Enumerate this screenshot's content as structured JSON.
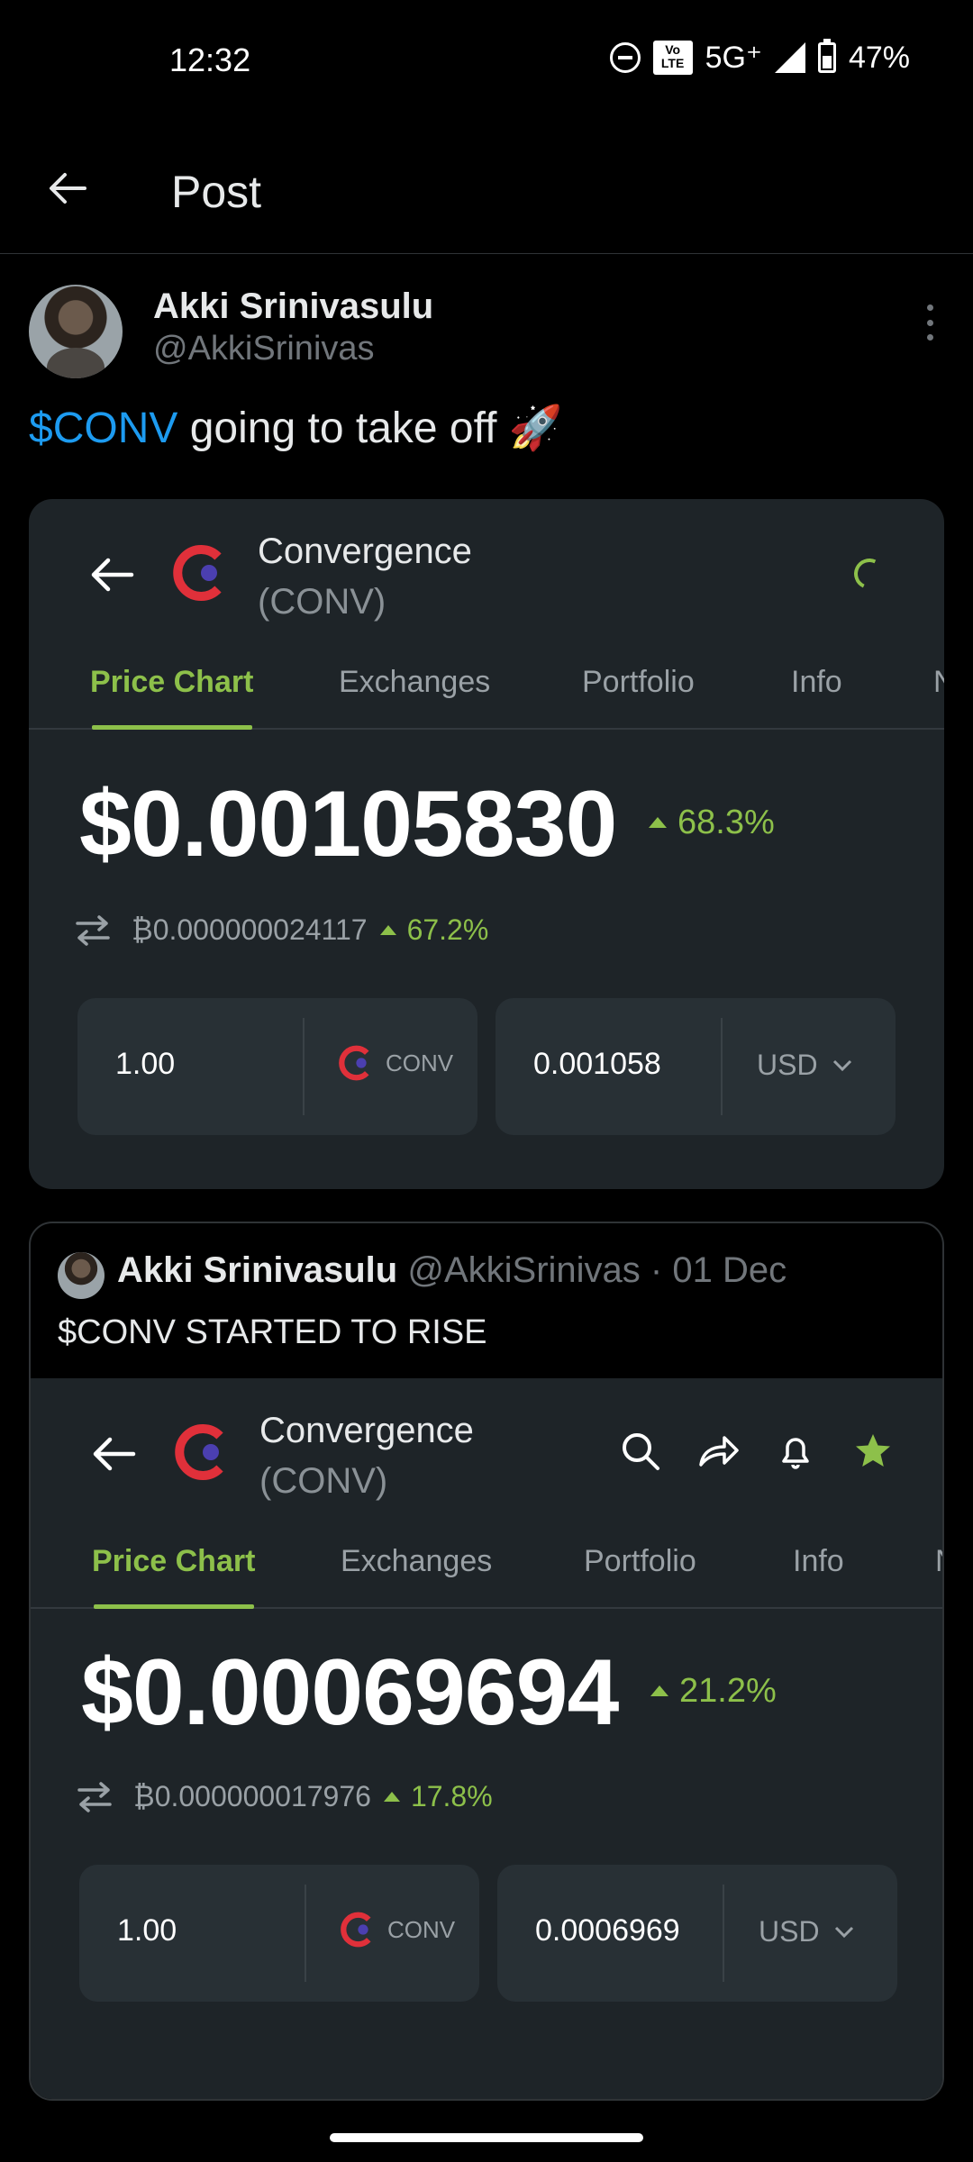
{
  "status_bar": {
    "time": "12:32",
    "network": "5G⁺",
    "battery": "47%",
    "volte": "Vo\nLTE"
  },
  "header": {
    "title": "Post"
  },
  "post": {
    "author_name": "Akki Srinivasulu",
    "author_handle": "@AkkiSrinivas",
    "cashtag": "$CONV",
    "text": " going to take off 🚀"
  },
  "card1": {
    "coin_name": "Convergence",
    "coin_symbol": "(CONV)",
    "tabs": [
      "Price Chart",
      "Exchanges",
      "Portfolio",
      "Info",
      "N"
    ],
    "price": "$0.00105830",
    "change": "68.3%",
    "btc_price": "₿0.000000024117",
    "btc_change": "67.2%",
    "amount": "1.00",
    "amount_unit": "CONV",
    "converted": "0.001058",
    "currency": "USD"
  },
  "quote": {
    "author_name": "Akki Srinivasulu",
    "meta": " @AkkiSrinivas · 01 Dec",
    "text": "$CONV STARTED TO RISE",
    "coin_name": "Convergence",
    "coin_symbol": "(CONV)",
    "tabs": [
      "Price Chart",
      "Exchanges",
      "Portfolio",
      "Info",
      "N"
    ],
    "price": "$0.00069694",
    "change": "21.2%",
    "btc_price": "₿0.000000017976",
    "btc_change": "17.8%",
    "amount": "1.00",
    "amount_unit": "CONV",
    "converted": "0.0006969",
    "currency": "USD"
  },
  "colors": {
    "accent_green": "#8dc04a",
    "link_blue": "#1d9bf0",
    "card_bg": "#1e2428"
  }
}
